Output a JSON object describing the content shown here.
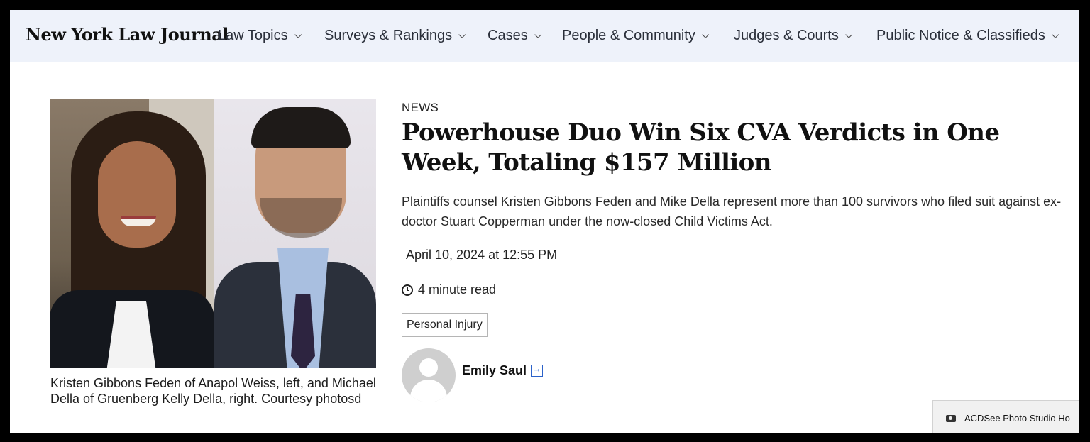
{
  "nav": {
    "logo": "New York Law Journal",
    "items": [
      {
        "label": "Law Topics"
      },
      {
        "label": "Surveys & Rankings"
      },
      {
        "label": "Cases"
      },
      {
        "label": "People & Community"
      },
      {
        "label": "Judges & Courts"
      },
      {
        "label": "Public Notice & Classifieds"
      }
    ]
  },
  "photo": {
    "caption": "Kristen Gibbons Feden of Anapol Weiss, left, and Michael Della of Gruenberg Kelly Della, right. Courtesy photosd"
  },
  "article": {
    "kicker": "NEWS",
    "headline": "Powerhouse Duo Win Six CVA Verdicts in One Week, Totaling $157 Million",
    "dek": "Plaintiffs counsel Kristen Gibbons Feden and Mike Della represent more than 100 survivors who filed suit against ex-doctor Stuart Copperman under the now-closed Child Victims Act.",
    "date": "April 10, 2024 at 12:55 PM",
    "read_time": "4 minute read",
    "tag": "Personal Injury",
    "author": "Emily Saul"
  },
  "toast": {
    "label": "ACDSee Photo Studio Ho"
  }
}
